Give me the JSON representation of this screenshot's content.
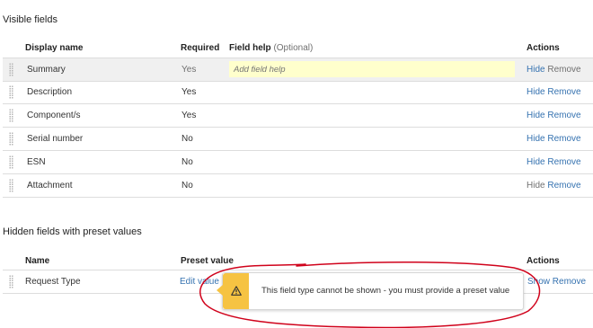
{
  "visible_section": {
    "title": "Visible fields",
    "headers": {
      "display_name": "Display name",
      "required": "Required",
      "field_help": "Field help",
      "field_help_optional": "(Optional)",
      "actions": "Actions"
    },
    "help_placeholder": "Add field help",
    "rows": [
      {
        "name": "Summary",
        "required": "Yes",
        "hide": "Hide",
        "remove": "Remove"
      },
      {
        "name": "Description",
        "required": "Yes",
        "hide": "Hide",
        "remove": "Remove"
      },
      {
        "name": "Component/s",
        "required": "Yes",
        "hide": "Hide",
        "remove": "Remove"
      },
      {
        "name": "Serial number",
        "required": "No",
        "hide": "Hide",
        "remove": "Remove"
      },
      {
        "name": "ESN",
        "required": "No",
        "hide": "Hide",
        "remove": "Remove"
      },
      {
        "name": "Attachment",
        "required": "No",
        "hide": "Hide",
        "remove": "Remove"
      }
    ]
  },
  "hidden_section": {
    "title": "Hidden fields with preset values",
    "headers": {
      "name": "Name",
      "preset_value": "Preset value",
      "actions": "Actions"
    },
    "rows": [
      {
        "name": "Request Type",
        "preset": "Edit value",
        "show": "Show",
        "remove": "Remove"
      }
    ]
  },
  "tooltip": {
    "icon": "warning-icon",
    "message": "This field type cannot be shown - you must provide a preset value"
  },
  "annotation_color": "#d0021b",
  "colors": {
    "link": "#3572b0",
    "tooltip_accent": "#f6c342",
    "help_bg": "#ffffcc"
  }
}
